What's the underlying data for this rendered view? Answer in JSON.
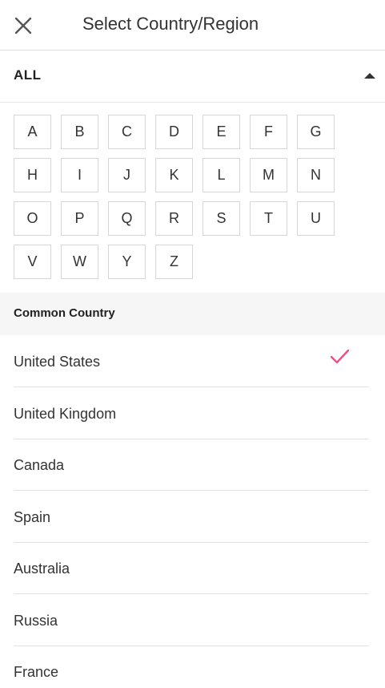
{
  "header": {
    "title": "Select Country/Region",
    "close_icon": "close-icon"
  },
  "filter": {
    "all_label": "ALL",
    "caret_icon": "caret-up-icon"
  },
  "letters": [
    "A",
    "B",
    "C",
    "D",
    "E",
    "F",
    "G",
    "H",
    "I",
    "J",
    "K",
    "L",
    "M",
    "N",
    "O",
    "P",
    "Q",
    "R",
    "S",
    "T",
    "U",
    "V",
    "W",
    "Y",
    "Z"
  ],
  "common": {
    "title": "Common Country",
    "countries": [
      {
        "name": "United States",
        "selected": true
      },
      {
        "name": "United Kingdom",
        "selected": false
      },
      {
        "name": "Canada",
        "selected": false
      },
      {
        "name": "Spain",
        "selected": false
      },
      {
        "name": "Australia",
        "selected": false
      },
      {
        "name": "Russia",
        "selected": false
      },
      {
        "name": "France",
        "selected": false
      }
    ]
  },
  "colors": {
    "accent": "#e8528a",
    "divider": "#e2e2e2",
    "section_bg": "#f6f6f6"
  }
}
